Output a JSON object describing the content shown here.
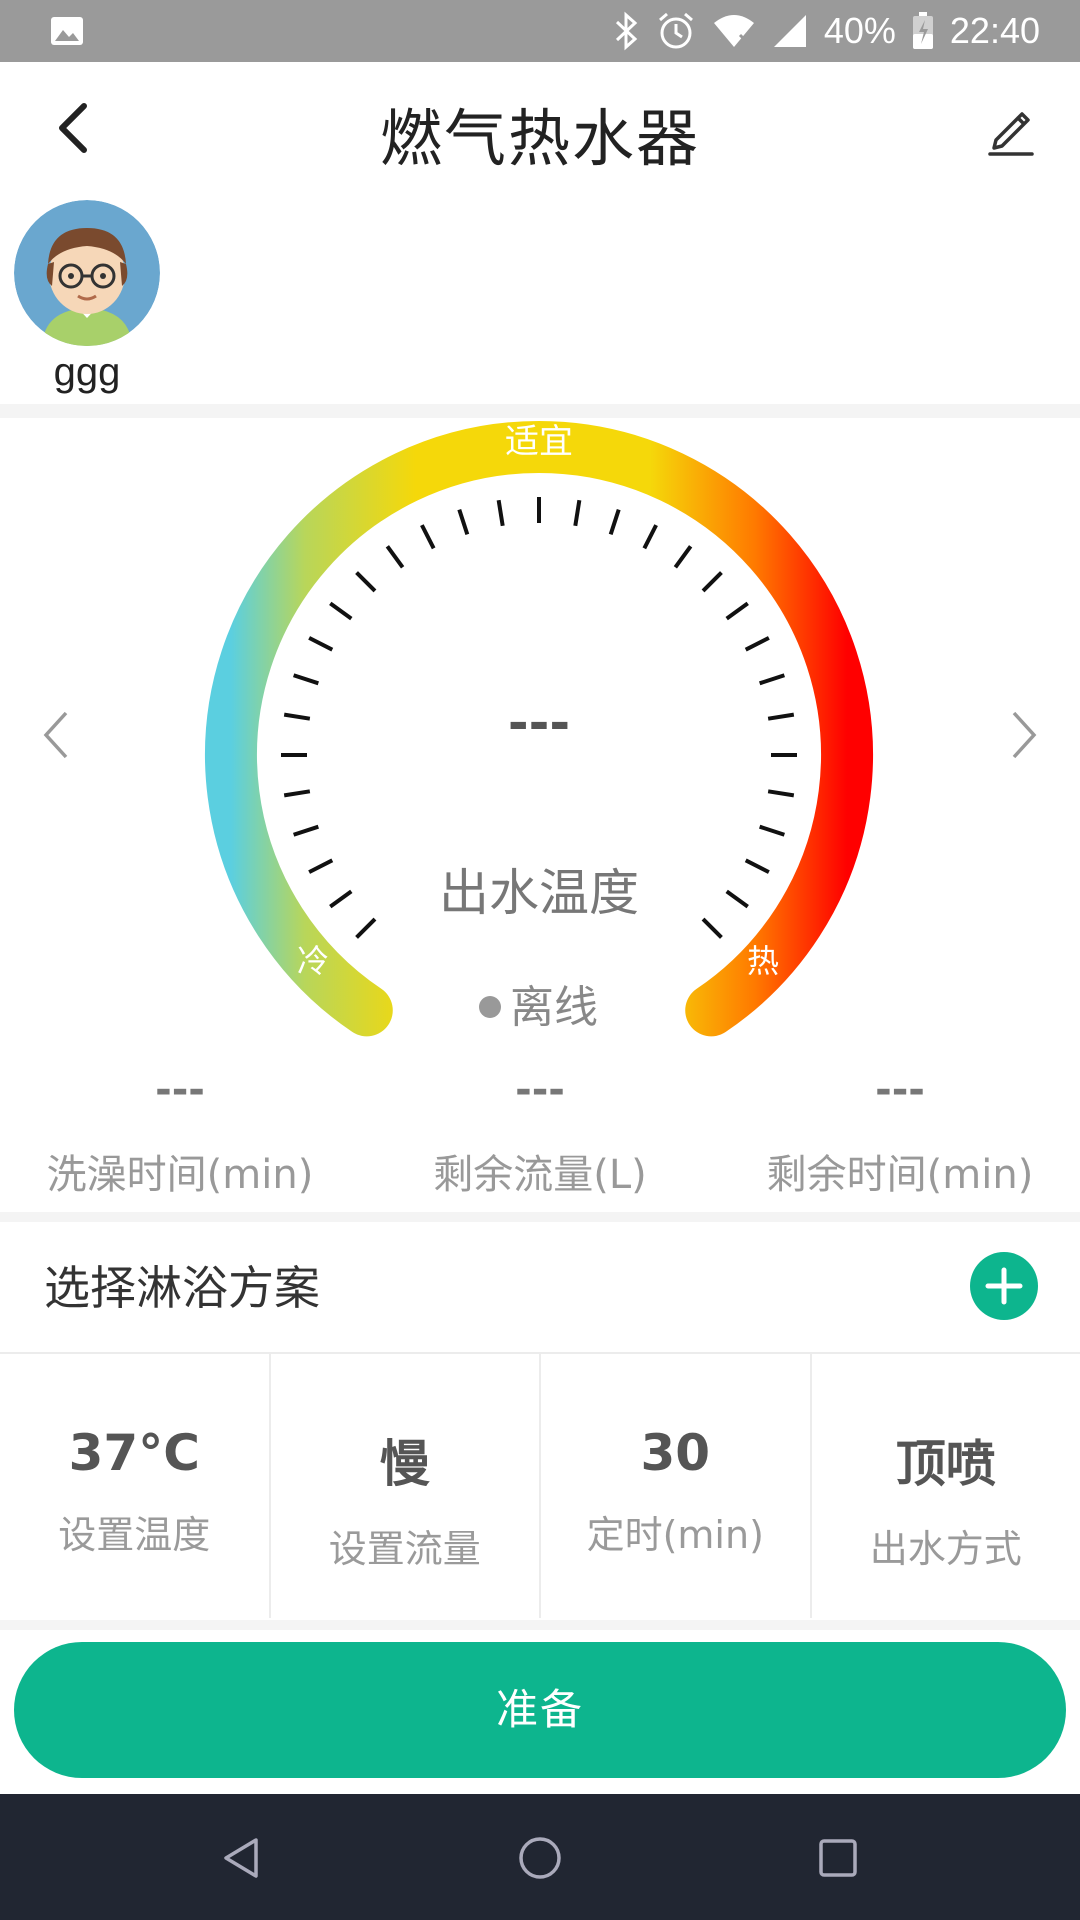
{
  "status_bar": {
    "battery": "40%",
    "time": "22:40"
  },
  "header": {
    "title": "燃气热水器"
  },
  "user": {
    "name": "ggg"
  },
  "gauge": {
    "label_top": "适宜",
    "label_cold": "冷",
    "label_hot": "热",
    "value": "---",
    "caption": "出水温度",
    "status": "离线",
    "colors": {
      "cold": "#5bcfe0",
      "mid": "#f5d80a",
      "warm": "#ff7a00",
      "hot": "#ff0000"
    }
  },
  "stats": [
    {
      "value": "---",
      "label": "洗澡时间(min)"
    },
    {
      "value": "---",
      "label": "剩余流量(L)"
    },
    {
      "value": "---",
      "label": "剩余时间(min)"
    }
  ],
  "plan": {
    "title": "选择淋浴方案",
    "items": [
      {
        "value": "37°C",
        "label": "设置温度"
      },
      {
        "value": "慢",
        "label": "设置流量"
      },
      {
        "value": "30",
        "label": "定时(min)"
      },
      {
        "value": "顶喷",
        "label": "出水方式"
      }
    ]
  },
  "ready_button": "准备",
  "accent_color": "#0db58e"
}
